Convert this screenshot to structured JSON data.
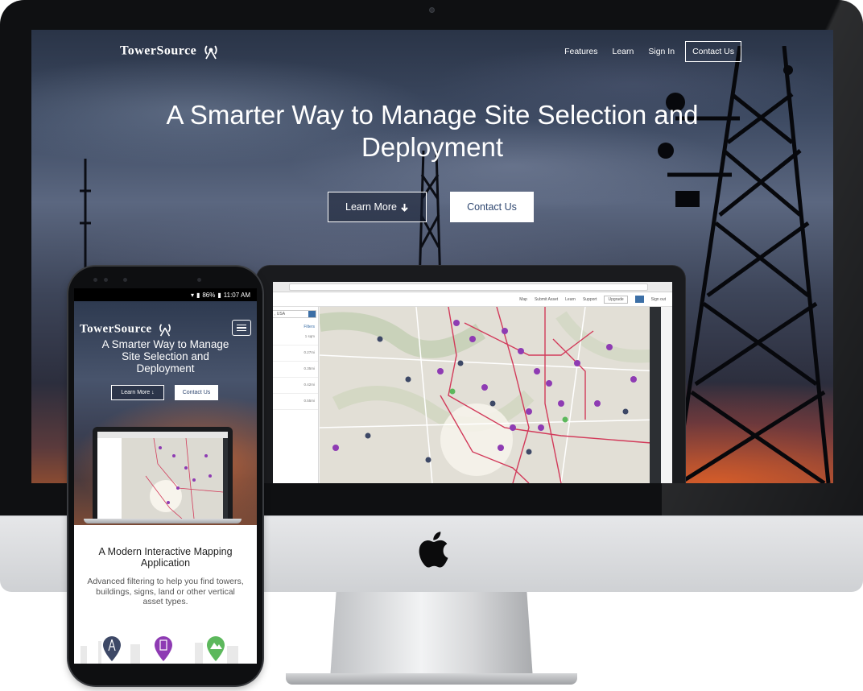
{
  "brand": {
    "logo_text": "TowerSource",
    "colors": {
      "accent_blue": "#2f4770",
      "pin_purple": "#8e3bb3",
      "pin_navy": "#3d4866",
      "pin_green": "#5cb85c",
      "route_red": "#d23a5a"
    }
  },
  "desktop": {
    "nav": {
      "features": "Features",
      "learn": "Learn",
      "sign_in": "Sign In",
      "contact": "Contact Us"
    },
    "hero": {
      "title_line1": "A Smarter Way to Manage Site Selection and",
      "title_line2": "Deployment",
      "learn_more": "Learn More",
      "learn_more_icon": "arrow-down-icon",
      "contact": "Contact Us"
    },
    "app_preview": {
      "header_links": [
        "Map",
        "Submit Asset",
        "Learn",
        "Support"
      ],
      "upgrade": "Upgrade",
      "sign_out": "Sign out",
      "search_value": ", USA",
      "filters": "Filters",
      "rows": [
        "1 sqm",
        "0.27mi",
        "0.35mi",
        "0.42mi",
        "0.55mi"
      ]
    }
  },
  "phone": {
    "status": {
      "battery": "86%",
      "time": "11:07 AM"
    },
    "hero": {
      "title_line1": "A Smarter Way to Manage",
      "title_line2": "Site Selection and",
      "title_line3": "Deployment",
      "learn_more": "Learn More",
      "contact": "Contact Us"
    },
    "section": {
      "title_line1": "A Modern Interactive Mapping",
      "title_line2": "Application",
      "text_line1": "Advanced filtering to help you find towers,",
      "text_line2": "buildings, signs, land or other vertical",
      "text_line3": "asset types."
    },
    "asset_icons": [
      "tower-pin-icon",
      "building-pin-icon",
      "land-pin-icon"
    ]
  }
}
